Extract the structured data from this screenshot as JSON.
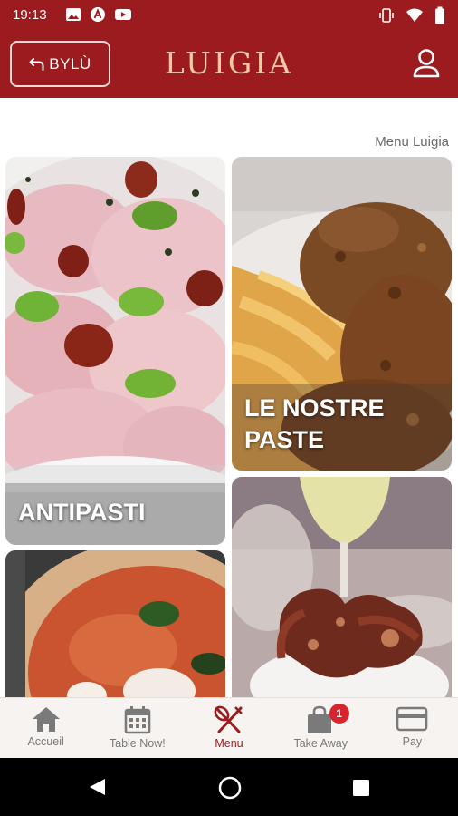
{
  "status_bar": {
    "time": "19:13",
    "left_icons": [
      "image-icon",
      "account-circle-a-icon",
      "youtube-icon"
    ],
    "right_icons": [
      "vibrate-icon",
      "wifi-icon",
      "battery-icon"
    ]
  },
  "app_bar": {
    "back_label": "BYLÙ",
    "back_icon": "undo-arrow-icon",
    "title": "LUIGIA",
    "account_icon": "person-icon",
    "colors": {
      "bar": "#9b1b1e",
      "title": "#f0c9a6"
    }
  },
  "main": {
    "breadcrumb": "Menu Luigia",
    "cards": [
      {
        "label": "ANTIPASTI"
      },
      {
        "label_line1": "LE NOSTRE",
        "label_line2": "PASTE"
      },
      {
        "label": ""
      },
      {
        "label": ""
      }
    ]
  },
  "bottom_nav": {
    "items": [
      {
        "label": "Accueil",
        "icon": "home-icon"
      },
      {
        "label": "Table Now!",
        "icon": "calendar-icon"
      },
      {
        "label": "Menu",
        "icon": "fork-knife-icon",
        "active": true
      },
      {
        "label": "Take Away",
        "icon": "shopping-bag-icon",
        "badge": "1"
      },
      {
        "label": "Pay",
        "icon": "credit-card-icon"
      }
    ],
    "colors": {
      "active": "#9b1b1e",
      "inactive": "#7a7a7a",
      "badge": "#d9232d"
    }
  },
  "system_nav": {
    "buttons": [
      "back-triangle-icon",
      "home-circle-icon",
      "recents-square-icon"
    ]
  }
}
